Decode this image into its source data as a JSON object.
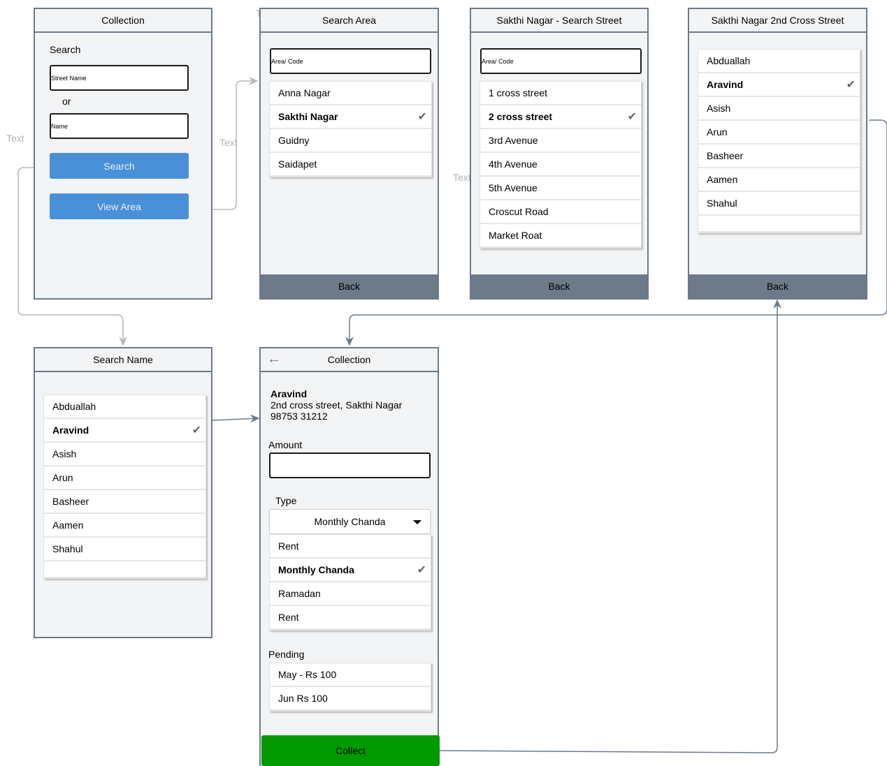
{
  "ghost_text": [
    "Text",
    "Text",
    "Text",
    "Text"
  ],
  "screen1": {
    "title": "Collection",
    "search_label": "Search",
    "street_placeholder": "Street Name",
    "or_label": "or",
    "name_placeholder": "Name",
    "search_button": "Search",
    "view_area_button": "View Area"
  },
  "screen2": {
    "title": "Search Area",
    "input_placeholder": "Area/ Code",
    "items": [
      "Anna Nagar",
      "Sakthi Nagar",
      "Guidny",
      "Saidapet"
    ],
    "selected_index": 1,
    "back": "Back"
  },
  "screen3": {
    "title": "Sakthi Nagar - Search Street",
    "input_placeholder": "Area/ Code",
    "items": [
      "1 cross street",
      "2 cross street",
      "3rd Avenue",
      "4th Avenue",
      "5th Avenue",
      "Croscut Road",
      "Market Roat"
    ],
    "selected_index": 1,
    "back": "Back"
  },
  "screen4": {
    "title": "Sakthi Nagar 2nd Cross Street",
    "items": [
      "Abduallah",
      "Aravind",
      "Asish",
      "Arun",
      "Basheer",
      "Aamen",
      "Shahul",
      ""
    ],
    "selected_index": 1,
    "back": "Back"
  },
  "screen5": {
    "title": "Search Name",
    "items": [
      "Abduallah",
      "Aravind",
      "Asish",
      "Arun",
      "Basheer",
      "Aamen",
      "Shahul",
      ""
    ],
    "selected_index": 1
  },
  "screen6": {
    "title": "Collection",
    "back_arrow": "←",
    "customer_name": "Aravind",
    "customer_address": "2nd cross street, Sakthi Nagar",
    "customer_phone": "98753 31212",
    "amount_label": "Amount",
    "amount_value": "",
    "type_label": "Type",
    "type_selected": "Monthly Chanda",
    "type_options": [
      "Rent",
      "Monthly Chanda",
      "Ramadan",
      "Rent"
    ],
    "type_selected_index": 1,
    "pending_label": "Pending",
    "pending_items": [
      "May - Rs 100",
      "Jun Rs 100"
    ],
    "collect_button": "Collect"
  },
  "check_glyph": "✔"
}
